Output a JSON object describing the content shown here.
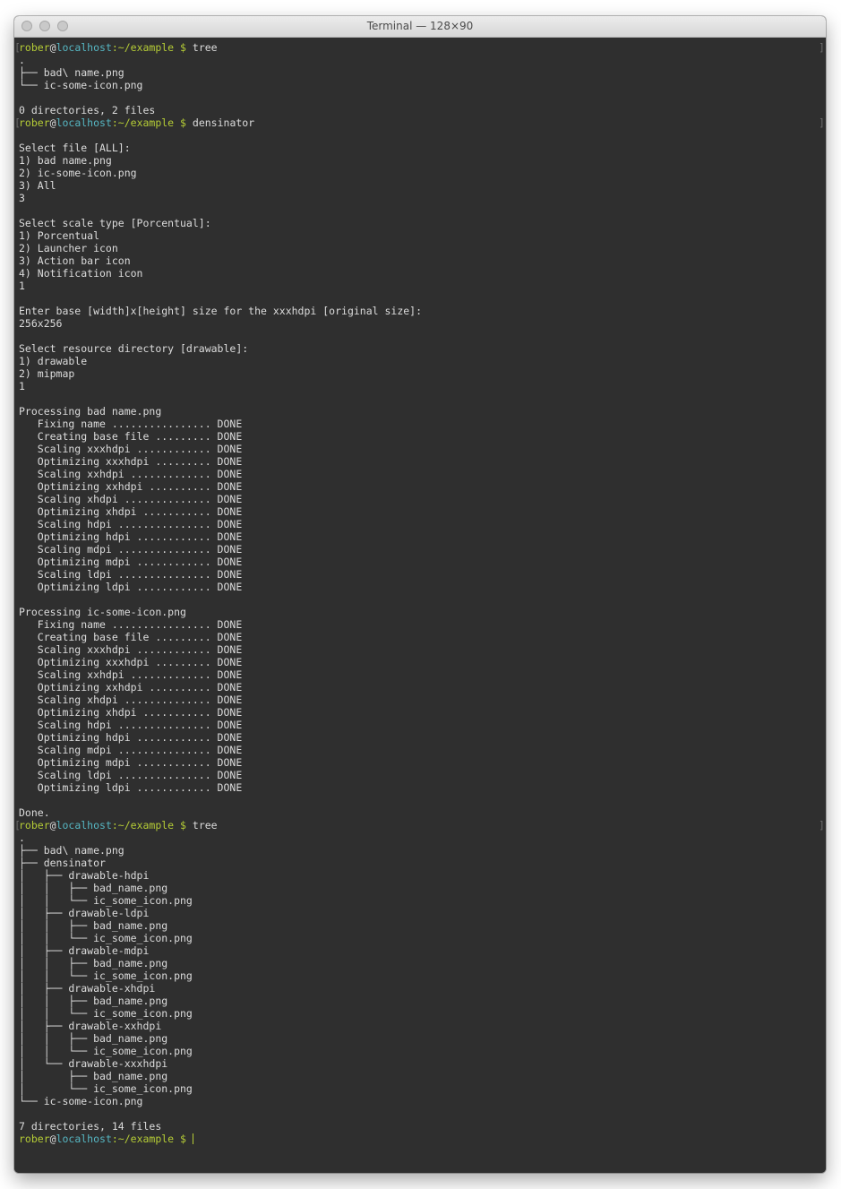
{
  "window": {
    "title": "Terminal — 128×90"
  },
  "prompt": {
    "user": "rober",
    "at": "@",
    "host": "localhost",
    "path": ":~/example",
    "symbol": " $ ",
    "bracket_left": "[",
    "bracket_right": "]"
  },
  "lines": [
    {
      "type": "prompt",
      "cmd": "tree"
    },
    {
      "type": "text",
      "text": "."
    },
    {
      "type": "text",
      "text": "├── bad\\ name.png"
    },
    {
      "type": "text",
      "text": "└── ic-some-icon.png"
    },
    {
      "type": "text",
      "text": ""
    },
    {
      "type": "text",
      "text": "0 directories, 2 files"
    },
    {
      "type": "prompt",
      "cmd": "densinator"
    },
    {
      "type": "text",
      "text": ""
    },
    {
      "type": "text",
      "text": "Select file [ALL]:"
    },
    {
      "type": "text",
      "text": "1) bad name.png"
    },
    {
      "type": "text",
      "text": "2) ic-some-icon.png"
    },
    {
      "type": "text",
      "text": "3) All"
    },
    {
      "type": "text",
      "text": "3"
    },
    {
      "type": "text",
      "text": ""
    },
    {
      "type": "text",
      "text": "Select scale type [Porcentual]:"
    },
    {
      "type": "text",
      "text": "1) Porcentual"
    },
    {
      "type": "text",
      "text": "2) Launcher icon"
    },
    {
      "type": "text",
      "text": "3) Action bar icon"
    },
    {
      "type": "text",
      "text": "4) Notification icon"
    },
    {
      "type": "text",
      "text": "1"
    },
    {
      "type": "text",
      "text": ""
    },
    {
      "type": "text",
      "text": "Enter base [width]x[height] size for the xxxhdpi [original size]:"
    },
    {
      "type": "text",
      "text": "256x256"
    },
    {
      "type": "text",
      "text": ""
    },
    {
      "type": "text",
      "text": "Select resource directory [drawable]:"
    },
    {
      "type": "text",
      "text": "1) drawable"
    },
    {
      "type": "text",
      "text": "2) mipmap"
    },
    {
      "type": "text",
      "text": "1"
    },
    {
      "type": "text",
      "text": ""
    },
    {
      "type": "text",
      "text": "Processing bad name.png"
    },
    {
      "type": "text",
      "text": "   Fixing name ................ DONE"
    },
    {
      "type": "text",
      "text": "   Creating base file ......... DONE"
    },
    {
      "type": "text",
      "text": "   Scaling xxxhdpi ............ DONE"
    },
    {
      "type": "text",
      "text": "   Optimizing xxxhdpi ......... DONE"
    },
    {
      "type": "text",
      "text": "   Scaling xxhdpi ............. DONE"
    },
    {
      "type": "text",
      "text": "   Optimizing xxhdpi .......... DONE"
    },
    {
      "type": "text",
      "text": "   Scaling xhdpi .............. DONE"
    },
    {
      "type": "text",
      "text": "   Optimizing xhdpi ........... DONE"
    },
    {
      "type": "text",
      "text": "   Scaling hdpi ............... DONE"
    },
    {
      "type": "text",
      "text": "   Optimizing hdpi ............ DONE"
    },
    {
      "type": "text",
      "text": "   Scaling mdpi ............... DONE"
    },
    {
      "type": "text",
      "text": "   Optimizing mdpi ............ DONE"
    },
    {
      "type": "text",
      "text": "   Scaling ldpi ............... DONE"
    },
    {
      "type": "text",
      "text": "   Optimizing ldpi ............ DONE"
    },
    {
      "type": "text",
      "text": ""
    },
    {
      "type": "text",
      "text": "Processing ic-some-icon.png"
    },
    {
      "type": "text",
      "text": "   Fixing name ................ DONE"
    },
    {
      "type": "text",
      "text": "   Creating base file ......... DONE"
    },
    {
      "type": "text",
      "text": "   Scaling xxxhdpi ............ DONE"
    },
    {
      "type": "text",
      "text": "   Optimizing xxxhdpi ......... DONE"
    },
    {
      "type": "text",
      "text": "   Scaling xxhdpi ............. DONE"
    },
    {
      "type": "text",
      "text": "   Optimizing xxhdpi .......... DONE"
    },
    {
      "type": "text",
      "text": "   Scaling xhdpi .............. DONE"
    },
    {
      "type": "text",
      "text": "   Optimizing xhdpi ........... DONE"
    },
    {
      "type": "text",
      "text": "   Scaling hdpi ............... DONE"
    },
    {
      "type": "text",
      "text": "   Optimizing hdpi ............ DONE"
    },
    {
      "type": "text",
      "text": "   Scaling mdpi ............... DONE"
    },
    {
      "type": "text",
      "text": "   Optimizing mdpi ............ DONE"
    },
    {
      "type": "text",
      "text": "   Scaling ldpi ............... DONE"
    },
    {
      "type": "text",
      "text": "   Optimizing ldpi ............ DONE"
    },
    {
      "type": "text",
      "text": ""
    },
    {
      "type": "text",
      "text": "Done."
    },
    {
      "type": "prompt",
      "cmd": "tree"
    },
    {
      "type": "text",
      "text": "."
    },
    {
      "type": "text",
      "text": "├── bad\\ name.png"
    },
    {
      "type": "text",
      "text": "├── densinator"
    },
    {
      "type": "text",
      "text": "│   ├── drawable-hdpi"
    },
    {
      "type": "text",
      "text": "│   │   ├── bad_name.png"
    },
    {
      "type": "text",
      "text": "│   │   └── ic_some_icon.png"
    },
    {
      "type": "text",
      "text": "│   ├── drawable-ldpi"
    },
    {
      "type": "text",
      "text": "│   │   ├── bad_name.png"
    },
    {
      "type": "text",
      "text": "│   │   └── ic_some_icon.png"
    },
    {
      "type": "text",
      "text": "│   ├── drawable-mdpi"
    },
    {
      "type": "text",
      "text": "│   │   ├── bad_name.png"
    },
    {
      "type": "text",
      "text": "│   │   └── ic_some_icon.png"
    },
    {
      "type": "text",
      "text": "│   ├── drawable-xhdpi"
    },
    {
      "type": "text",
      "text": "│   │   ├── bad_name.png"
    },
    {
      "type": "text",
      "text": "│   │   └── ic_some_icon.png"
    },
    {
      "type": "text",
      "text": "│   ├── drawable-xxhdpi"
    },
    {
      "type": "text",
      "text": "│   │   ├── bad_name.png"
    },
    {
      "type": "text",
      "text": "│   │   └── ic_some_icon.png"
    },
    {
      "type": "text",
      "text": "│   └── drawable-xxxhdpi"
    },
    {
      "type": "text",
      "text": "│       ├── bad_name.png"
    },
    {
      "type": "text",
      "text": "│       └── ic_some_icon.png"
    },
    {
      "type": "text",
      "text": "└── ic-some-icon.png"
    },
    {
      "type": "text",
      "text": ""
    },
    {
      "type": "text",
      "text": "7 directories, 14 files"
    },
    {
      "type": "active_prompt",
      "cmd": ""
    }
  ],
  "colors": {
    "background": "#2f2f2f",
    "text": "#dcdcdc",
    "user": "#b5cc36",
    "host": "#56b6c2"
  }
}
